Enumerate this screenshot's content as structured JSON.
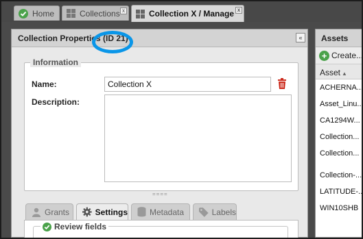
{
  "tabs": [
    {
      "label": "Home",
      "icon": "check-circle-icon"
    },
    {
      "label": "Collections",
      "icon": "grid-icon",
      "close": "x"
    },
    {
      "label": "Collection X / Manage",
      "icon": "grid-icon",
      "close": "x"
    }
  ],
  "panel": {
    "title": "Collection Properties (ID 21)",
    "collapse": "«",
    "highlight_color": "#0a96e8"
  },
  "information": {
    "legend": "Information",
    "name_label": "Name:",
    "name_value": "Collection X",
    "description_label": "Description:",
    "description_value": "",
    "splitter": "===="
  },
  "subtabs": [
    {
      "label": "Grants",
      "icon": "user-icon"
    },
    {
      "label": "Settings",
      "icon": "gear-icon",
      "active": true
    },
    {
      "label": "Metadata",
      "icon": "database-icon"
    },
    {
      "label": "Labels",
      "icon": "tag-icon"
    }
  ],
  "review_fields": {
    "legend": "Review fields"
  },
  "assets": {
    "title": "Assets",
    "create_label": "Create...",
    "column": "Asset",
    "rows": [
      "ACHERNA...",
      "Asset_Linu...",
      "CA1294W...",
      "Collection...",
      "Collection...",
      "Collection-...",
      "LATITUDE-...",
      "WIN10SHB"
    ]
  }
}
